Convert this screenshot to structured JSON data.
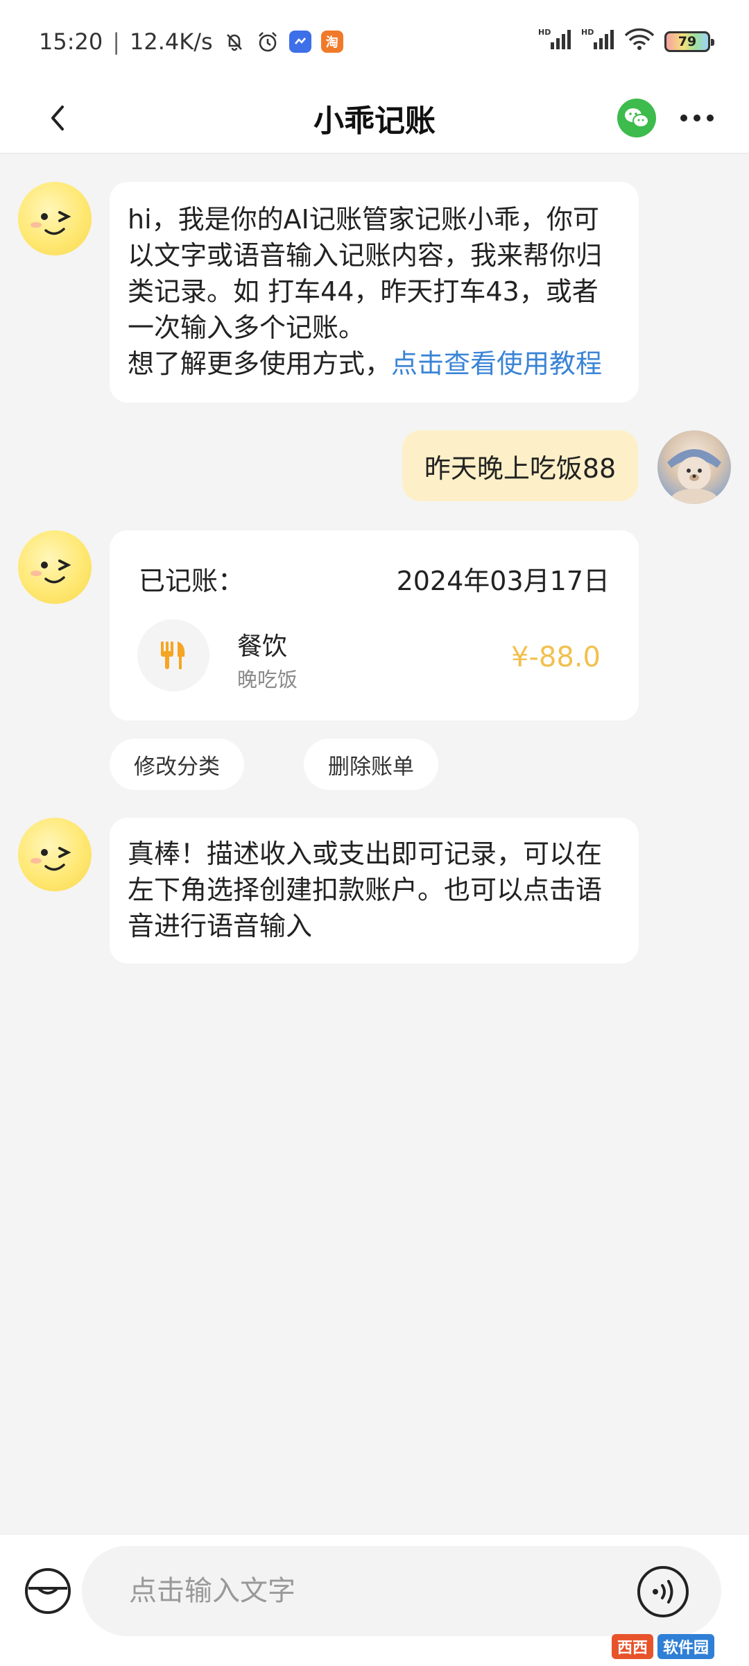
{
  "status_bar": {
    "time": "15:20",
    "network_speed": "12.4K/s",
    "battery_level": "79",
    "icons": [
      "mute-bell-icon",
      "alarm-icon",
      "app-badge-icon",
      "taobao-badge-icon",
      "signal-hd-icon",
      "signal-hd-icon",
      "wifi-icon",
      "battery-icon"
    ],
    "app_badge_2_text": "淘"
  },
  "header": {
    "title": "小乖记账",
    "icons": [
      "back-arrow-icon",
      "wechat-icon",
      "more-icon"
    ]
  },
  "messages": {
    "bot_welcome": {
      "text": "hi，我是你的AI记账管家记账小乖，你可以文字或语音输入记账内容，我来帮你归类记录。如 打车44，昨天打车43，或者一次输入多个记账。",
      "line1": "hi，我是你的AI记账管家记账小乖，你可",
      "line2": "以文字或语音输入记账内容，我来帮你归",
      "line3": "类记录。如 打车44，昨天打车43，或者",
      "line4": "一次输入多个记账。",
      "line5_prefix": "想了解更多使用方式，",
      "tutorial_link": "点击查看使用教程"
    },
    "user_message": {
      "text": "昨天晚上吃饭88"
    },
    "record_card": {
      "label": "已记账：",
      "date": "2024年03月17日",
      "category": "餐饮",
      "note": "晚吃饭",
      "amount": "¥-88.0",
      "category_icon": "fork-knife-icon",
      "amount_color": "#f2c04e"
    },
    "actions": {
      "modify_category": "修改分类",
      "delete_bill": "删除账单"
    },
    "bot_followup": {
      "line1": "真棒！描述收入或支出即可记录，可以在",
      "line2": "左下角选择创建扣款账户。也可以点击语",
      "line3": "音进行语音输入"
    }
  },
  "input_bar": {
    "placeholder": "点击输入文字",
    "value": "",
    "icons": [
      "account-wallet-icon",
      "voice-input-icon"
    ]
  },
  "watermark": {
    "logo": "西西",
    "text": "软件园"
  },
  "colors": {
    "link": "#3a84d6",
    "user_bubble": "#fdf0c8",
    "amount": "#f2c04e",
    "wechat_green": "#3dbb4c",
    "background": "#f4f4f4"
  }
}
